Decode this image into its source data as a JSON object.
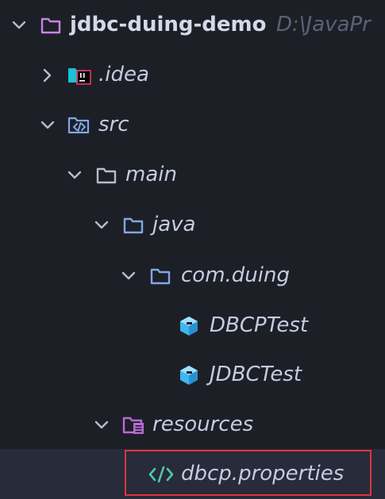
{
  "project": {
    "name": "jdbc-duing-demo",
    "path_hint": "D:\\JavaPr"
  },
  "tree": {
    "idea": {
      "label": ".idea",
      "icon": "idea-folder-icon",
      "state": "collapsed"
    },
    "src": {
      "label": "src",
      "icon": "source-folder-icon",
      "state": "expanded"
    },
    "main": {
      "label": "main",
      "icon": "folder-icon",
      "state": "expanded"
    },
    "java": {
      "label": "java",
      "icon": "java-source-root-icon",
      "state": "expanded"
    },
    "package": {
      "label": "com.duing",
      "icon": "package-folder-icon",
      "state": "expanded"
    },
    "class1": {
      "label": "DBCPTest",
      "icon": "java-class-icon"
    },
    "class2": {
      "label": "JDBCTest",
      "icon": "java-class-icon"
    },
    "resources": {
      "label": "resources",
      "icon": "resources-folder-icon",
      "state": "expanded"
    },
    "props": {
      "label": "dbcp.properties",
      "icon": "properties-file-icon",
      "selected": true
    }
  },
  "colors": {
    "background": "#1d1f27",
    "selected_row": "#272b3a",
    "highlight_border": "#e0343a",
    "root_folder": "#c586e6",
    "folder": "#7fa8e8",
    "java_class": "#3fb6f0",
    "properties_icon": "#4ec9a8"
  }
}
